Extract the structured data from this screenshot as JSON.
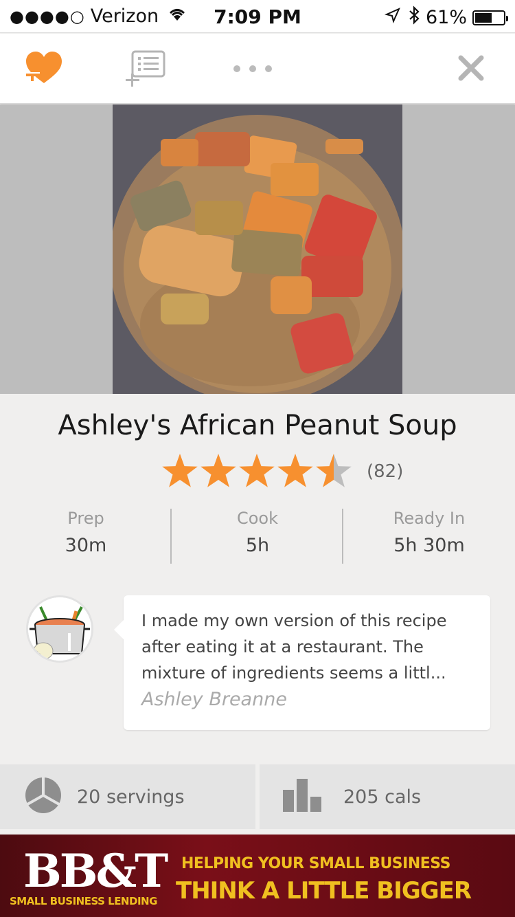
{
  "status_bar": {
    "signal": "●●●●○",
    "carrier": "Verizon",
    "time": "7:09 PM",
    "battery": "61%",
    "battery_level": 0.61
  },
  "toolbar": {
    "icons": [
      "heart-add-icon",
      "add-to-list-icon",
      "more-icon",
      "close-icon"
    ],
    "accent_color": "#f7902f"
  },
  "recipe": {
    "title": "Ashley's African Peanut Soup",
    "rating": 4.5,
    "rating_count": "(82)",
    "star_color": "#f7902f"
  },
  "times": {
    "prep_label": "Prep",
    "prep_value": "30m",
    "cook_label": "Cook",
    "cook_value": "5h",
    "ready_label": "Ready In",
    "ready_value": "5h 30m"
  },
  "review": {
    "text": "I made my own version of this recipe after eating it at a restaurant. The mixture of ingredients seems a littl...",
    "author": "Ashley Breanne"
  },
  "stats": {
    "servings": "20 servings",
    "calories": "205 cals"
  },
  "ad": {
    "brand": "BB&T",
    "sub": "SMALL BUSINESS LENDING",
    "line1": "HELPING YOUR SMALL BUSINESS",
    "line2": "THINK A LITTLE BIGGER"
  }
}
